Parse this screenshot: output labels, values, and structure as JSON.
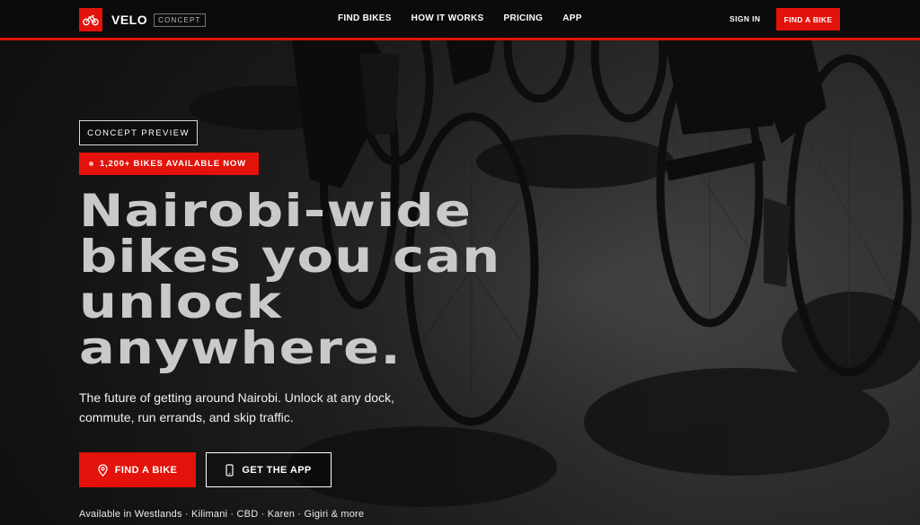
{
  "brand": {
    "name": "VELO",
    "tag": "CONCEPT",
    "logo_icon": "bicycle-icon",
    "accent": "#e3120b"
  },
  "nav": {
    "links": [
      "FIND BIKES",
      "HOW IT WORKS",
      "PRICING",
      "APP"
    ],
    "sign_in": "SIGN IN",
    "cta": "FIND A BIKE"
  },
  "hero": {
    "concept_badge": "CONCEPT PREVIEW",
    "availability": "1,200+ BIKES AVAILABLE NOW",
    "title_lines": [
      "Nairobi-wide",
      "bikes you can",
      "unlock",
      "anywhere."
    ],
    "description": "The future of getting around Nairobi. Unlock at any dock, commute, run errands, and skip traffic.",
    "primary_button": {
      "label": "FIND A BIKE",
      "icon": "map-pin-icon"
    },
    "secondary_button": {
      "label": "GET THE APP",
      "icon": "phone-icon"
    },
    "areas": "Available in Westlands · Kilimani · CBD · Karen · Gigiri & more"
  },
  "colors": {
    "accent": "#e3120b",
    "nav_bg": "#0b0b0b",
    "title": "#c9c9c9"
  }
}
